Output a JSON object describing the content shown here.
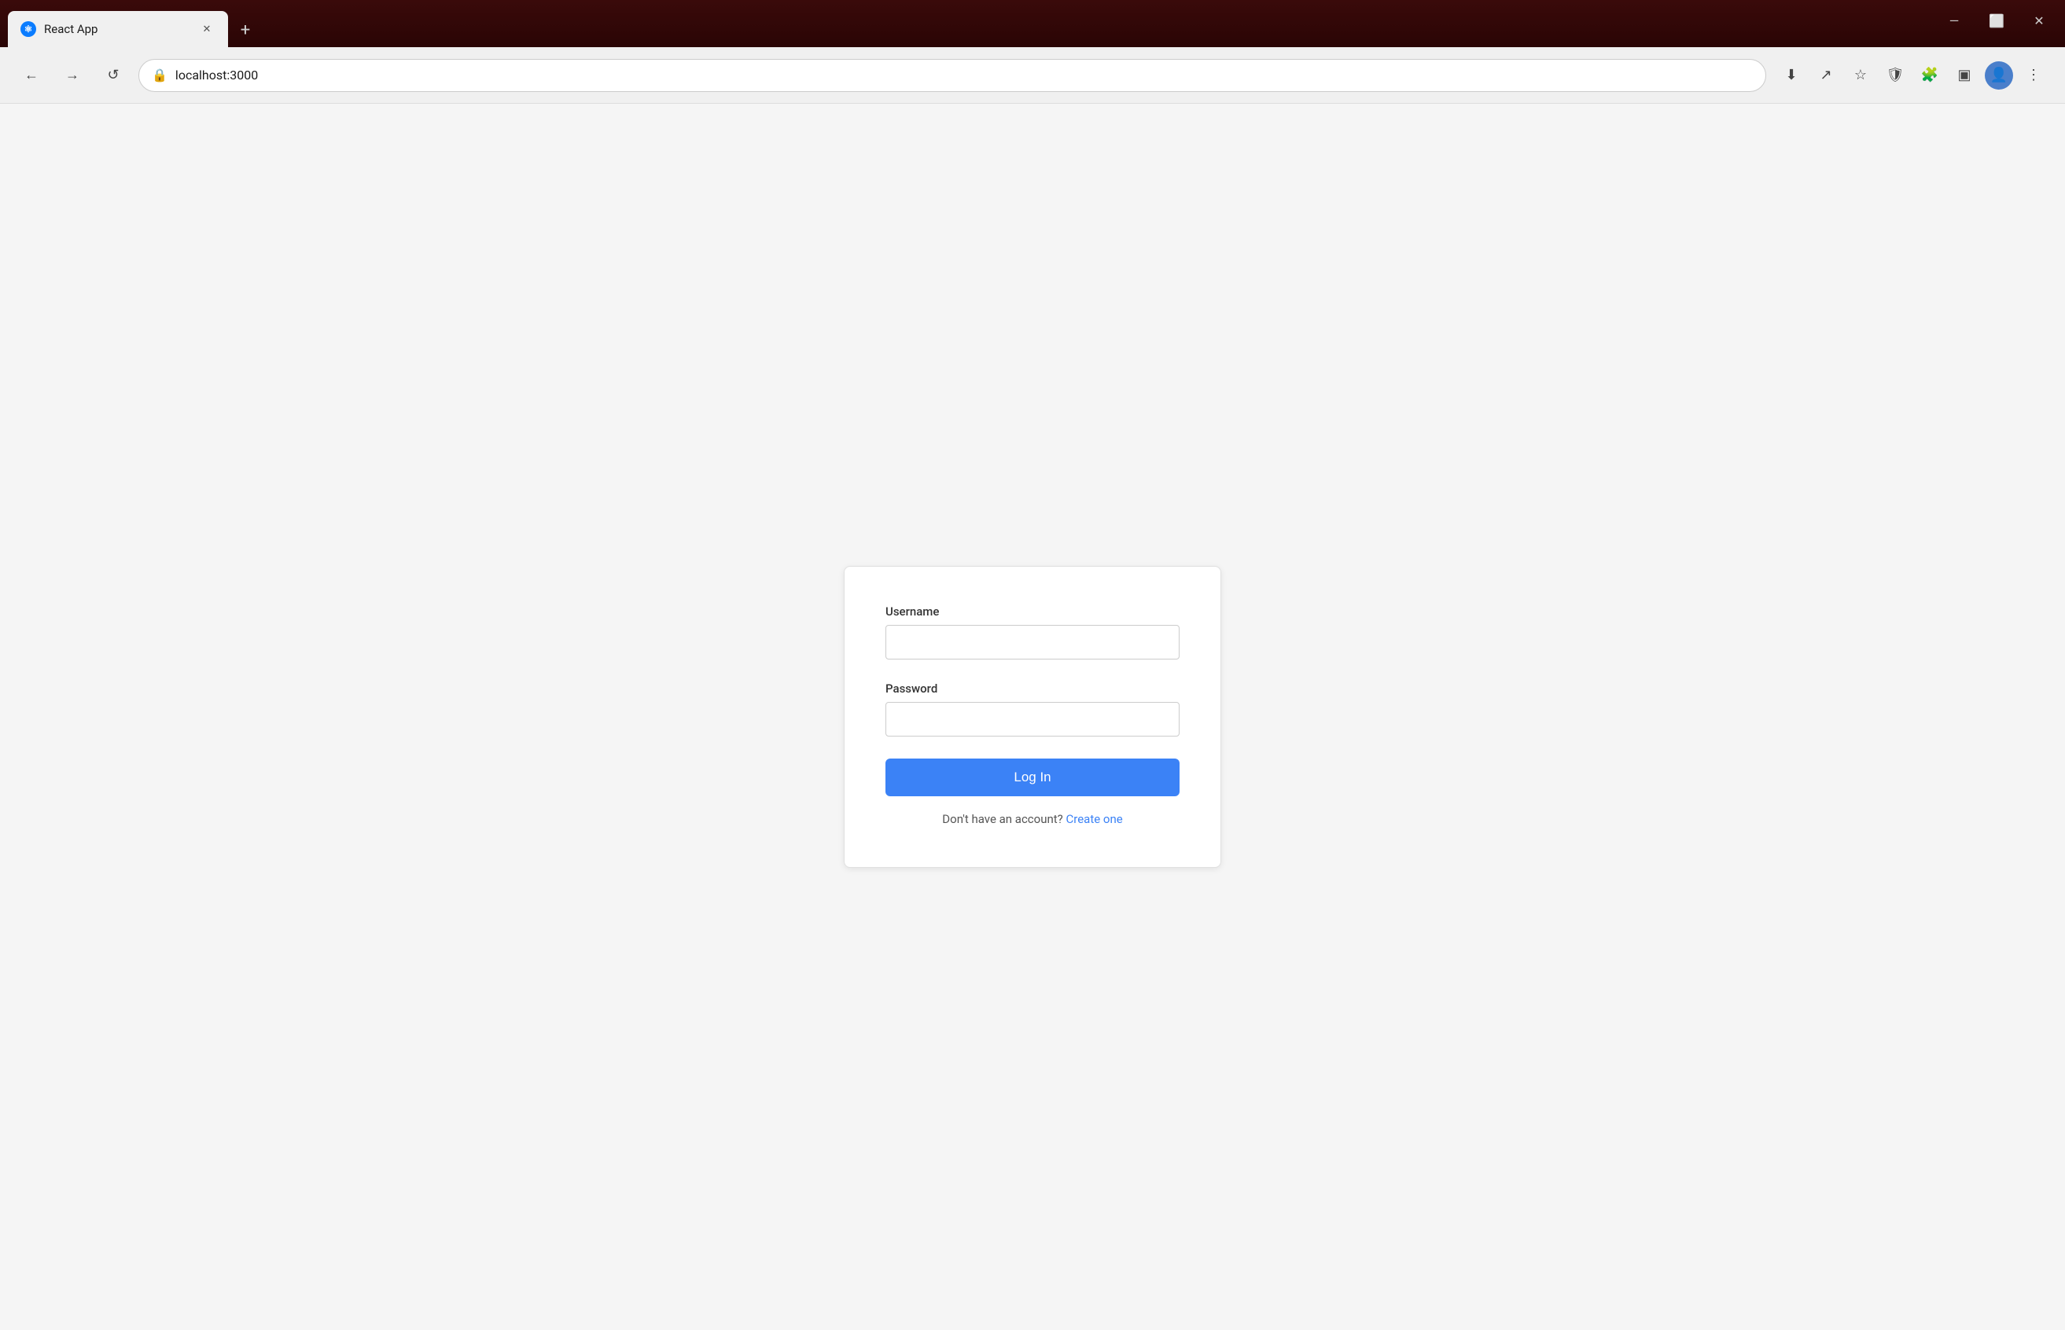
{
  "browser": {
    "title_bar": {
      "tab_title": "React App",
      "new_tab_label": "+",
      "favicon": "⚛"
    },
    "window_controls": {
      "minimize": "—",
      "restore": "⬜",
      "close": "✕",
      "vertical_dots": "⋮"
    },
    "nav_bar": {
      "back_label": "←",
      "forward_label": "→",
      "reload_label": "↺",
      "address": "localhost:3000",
      "lock_icon": "🔒",
      "download_icon": "⬇",
      "share_icon": "↗",
      "star_icon": "☆",
      "shield_icon": "🛡",
      "puzzle_icon": "🧩",
      "sidebar_icon": "▣",
      "profile_icon": "👤",
      "menu_icon": "⋮"
    }
  },
  "page": {
    "login_card": {
      "username_label": "Username",
      "username_placeholder": "",
      "password_label": "Password",
      "password_placeholder": "",
      "login_button_label": "Log In",
      "no_account_text": "Don't have an account?",
      "create_link_text": "Create one"
    }
  }
}
